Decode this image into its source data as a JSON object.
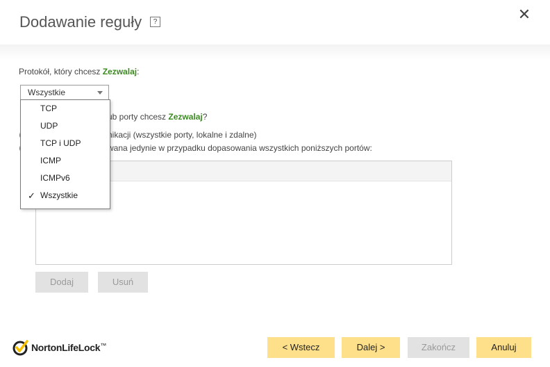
{
  "dialog": {
    "title": "Dodawanie reguły",
    "help_label": "?",
    "close_label": "✕"
  },
  "protocol_section": {
    "prompt": "Protokół, który chcesz ",
    "action": "Zezwalaj",
    "suffix": ":",
    "selected": "Wszystkie",
    "options": [
      "TCP",
      "UDP",
      "TCP i UDP",
      "ICMP",
      "ICMPv6",
      "Wszystkie"
    ],
    "checked_option": "Wszystkie"
  },
  "ports_section": {
    "prompt_visible": "ub porty chcesz ",
    "action": "Zezwalaj",
    "suffix": "?",
    "option1_visible": "nikacji (wszystkie porty, lokalne i zdalne)",
    "option2_visible": "wana jedynie w przypadku dopasowania wszystkich poniższych portów:"
  },
  "table_buttons": {
    "add": "Dodaj",
    "remove": "Usuń"
  },
  "footer": {
    "back": "< Wstecz",
    "next": "Dalej >",
    "finish": "Zakończ",
    "cancel": "Anuluj"
  },
  "brand": {
    "name": "NortonLifeLock",
    "tm": "™"
  },
  "colors": {
    "accent_green": "#3a8a1f",
    "button_yellow": "#ffe08a",
    "disabled_gray": "#e2e2e2",
    "brand_yellow": "#f7c100"
  },
  "icons": {
    "help": "question-mark-icon",
    "close": "close-icon",
    "check": "checkmark-icon",
    "select_arrow": "chevron-down-icon",
    "brand": "norton-checkmark-logo"
  }
}
